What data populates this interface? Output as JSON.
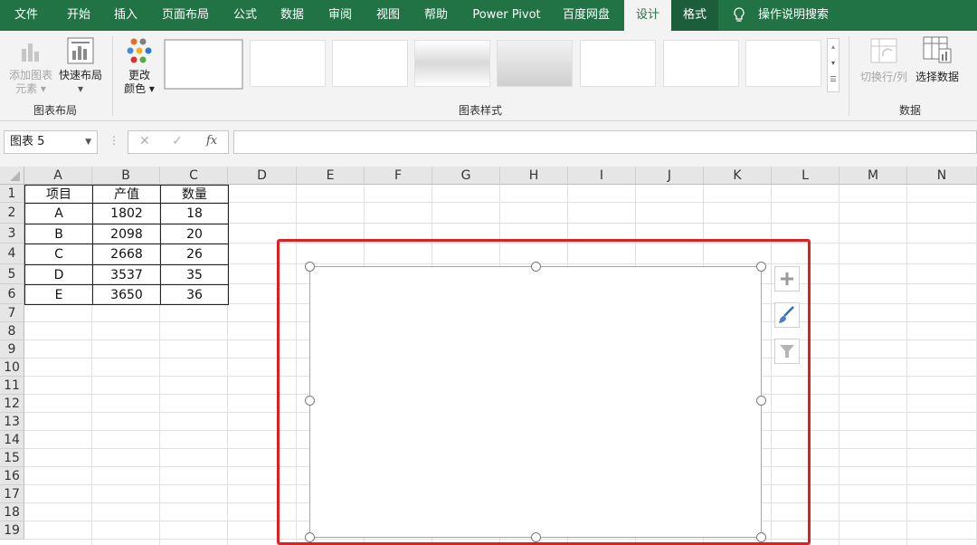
{
  "tabs": [
    "文件",
    "开始",
    "插入",
    "页面布局",
    "公式",
    "数据",
    "审阅",
    "视图",
    "帮助",
    "Power Pivot",
    "百度网盘",
    "设计",
    "格式",
    "操作说明搜索"
  ],
  "ribbon": {
    "add_element_label_1": "添加图表",
    "add_element_label_2": "元素",
    "quick_layout_label": "快速布局",
    "change_color_label_1": "更改",
    "change_color_label_2": "颜色",
    "layout_group": "图表布局",
    "styles_group": "图表样式",
    "switch_rowcol_label": "切换行/列",
    "select_data_label": "选择数据",
    "data_group": "数据"
  },
  "formula_bar": {
    "name_box": "图表 5",
    "cancel_glyph": "✕",
    "enter_glyph": "✓",
    "fx_glyph": "fx",
    "formula": ""
  },
  "columns": [
    "A",
    "B",
    "C",
    "D",
    "E",
    "F",
    "G",
    "H",
    "I",
    "J",
    "K",
    "L",
    "M",
    "N"
  ],
  "rows": [
    "1",
    "2",
    "3",
    "4",
    "5",
    "6",
    "7",
    "8",
    "9",
    "10",
    "11",
    "12",
    "13",
    "14",
    "15",
    "16",
    "17",
    "18",
    "19"
  ],
  "table": {
    "headers": [
      "项目",
      "产值",
      "数量"
    ],
    "rows": [
      [
        "A",
        "1802",
        "18"
      ],
      [
        "B",
        "2098",
        "20"
      ],
      [
        "C",
        "2668",
        "26"
      ],
      [
        "D",
        "3537",
        "35"
      ],
      [
        "E",
        "3650",
        "36"
      ]
    ]
  },
  "chart_tools": [
    "plus-icon",
    "brush-icon",
    "filter-icon"
  ],
  "colors": {
    "excel_green": "#217346",
    "highlight_red": "#e02020"
  }
}
